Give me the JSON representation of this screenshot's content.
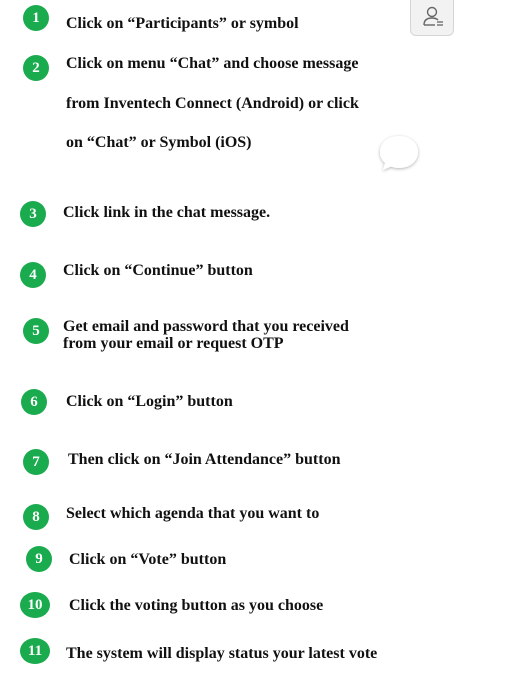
{
  "steps": [
    {
      "number": "1",
      "lines": [
        "Click on “Participants” or symbol"
      ]
    },
    {
      "number": "2",
      "lines": [
        "Click on menu “Chat” and choose message",
        "from Inventech Connect (Android) or click",
        "on “Chat” or Symbol (iOS)"
      ]
    },
    {
      "number": "3",
      "lines": [
        "Click link in the chat message."
      ]
    },
    {
      "number": "4",
      "lines": [
        "Click on “Continue” button"
      ]
    },
    {
      "number": "5",
      "lines": [
        "Get email and password that you received",
        "from your email or request OTP"
      ]
    },
    {
      "number": "6",
      "lines": [
        "Click on “Login” button"
      ]
    },
    {
      "number": "7",
      "lines": [
        "Then click on “Join Attendance” button"
      ]
    },
    {
      "number": "8",
      "lines": [
        "Select which agenda that you want to"
      ]
    },
    {
      "number": "9",
      "lines": [
        "Click on “Vote” button"
      ]
    },
    {
      "number": "10",
      "lines": [
        "Click the voting button as you choose"
      ]
    },
    {
      "number": "11",
      "lines": [
        "The system will display status your latest vote"
      ]
    }
  ],
  "icons": {
    "participants": "participants-icon",
    "chat": "chat-bubble-icon"
  },
  "colors": {
    "badge": "#1aab4e",
    "text": "#111111"
  }
}
